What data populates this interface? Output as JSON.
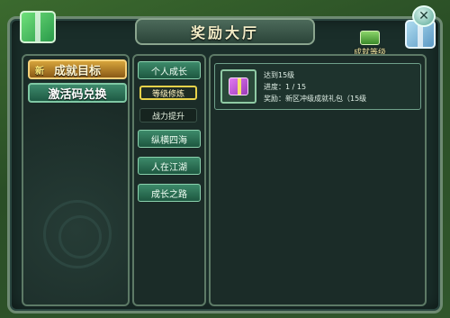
{
  "window": {
    "title": "奖励大厅",
    "close_glyph": "✕"
  },
  "achieve_level": {
    "label": "成就等级",
    "icon": "gift-box-icon"
  },
  "left_tabs": [
    {
      "label": "成就目标",
      "badge": "新",
      "active": true
    },
    {
      "label": "激活码兑换",
      "active": false
    }
  ],
  "categories": [
    {
      "label": "个人成长"
    },
    {
      "label": "纵横四海"
    },
    {
      "label": "人在江湖"
    },
    {
      "label": "成长之路"
    }
  ],
  "sub_categories": [
    {
      "label": "等级修炼",
      "active": true
    },
    {
      "label": "战力提升",
      "active": false
    }
  ],
  "task": {
    "title": "达到15级",
    "progress": "进度：1 / 15",
    "reward": "奖励：新区冲级成就礼包（15级",
    "icon": "gift-box-icon"
  },
  "colors": {
    "accent_gold": "#d6a43c",
    "tab_green": "#3e8a6c",
    "highlight_yellow": "#e8d24a"
  }
}
